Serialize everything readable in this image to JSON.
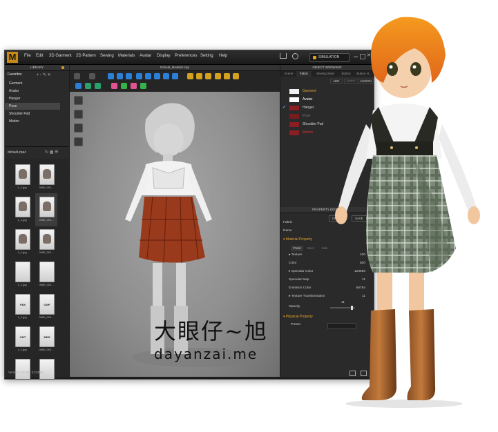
{
  "app": {
    "logo": "M",
    "menu": [
      "File",
      "Edit",
      "3D Garment",
      "2D Pattern",
      "Sewing",
      "Materials",
      "Avatar",
      "Display",
      "Preferences",
      "Setting",
      "Help"
    ],
    "simulation_label": "SIMULATION",
    "viewport_title": "Default_Modelist.zprj",
    "status_text": "Version: 2.2.107 (r12392)"
  },
  "library": {
    "header": "LIBRARY",
    "section_title": "Favorites",
    "items": [
      "Garment",
      "Avatar",
      "Hanger",
      "Pose",
      "Shoulder Pad",
      "Motion"
    ],
    "selected_item": "Pose",
    "folder_label": "default.zpac",
    "thumbnails": [
      {
        "label": "1_1.jpg",
        "tag": ""
      },
      {
        "label": "0060_001...",
        "tag": ""
      },
      {
        "label": "1_1.jpg",
        "tag": ""
      },
      {
        "label": "0060_001...",
        "tag": ""
      },
      {
        "label": "1_1.jpg",
        "tag": ""
      },
      {
        "label": "0060_001...",
        "tag": ""
      },
      {
        "label": "1_1.jpg",
        "tag": ""
      },
      {
        "label": "0060_001...",
        "tag": ""
      },
      {
        "label": "1_1.jpg",
        "tag": "FBX"
      },
      {
        "label": "0060_001...",
        "tag": "CMP"
      },
      {
        "label": "1_1.jpg",
        "tag": "CMT"
      },
      {
        "label": "0060_001...",
        "tag": "MDD"
      }
    ]
  },
  "object_browser": {
    "header": "OBJECT BROWSER",
    "tabs": [
      "Scene",
      "Fabric",
      "Sewing Style",
      "Button",
      "Button H..."
    ],
    "active_tab": "Fabric",
    "buttons": [
      "ADD",
      "COPY",
      "ASSIGN"
    ],
    "items": [
      {
        "name": "Garment",
        "color": "#f0f0f0",
        "text_color": "#e8a32c",
        "checked": false
      },
      {
        "name": "Avatar",
        "color": "#ffffff",
        "text_color": "#ffffff",
        "checked": false
      },
      {
        "name": "Hanger",
        "color": "#8a1e22",
        "text_color": "#d8d8d8",
        "checked": true
      },
      {
        "name": "Pose",
        "color": "#7a1c1e",
        "text_color": "#777777",
        "checked": false
      },
      {
        "name": "Shoulder Pad",
        "color": "#8a1e22",
        "text_color": "#d8d8d8",
        "checked": false
      },
      {
        "name": "Motion",
        "color": "#8a1e22",
        "text_color": "#e03030",
        "checked": false
      }
    ]
  },
  "property_editor": {
    "header": "PROPERTY EDITOR",
    "buttons": [
      "OPEN",
      "SAVE"
    ],
    "rows": [
      {
        "label": "Fabric",
        "value": ""
      },
      {
        "label": "Name",
        "value": ""
      }
    ],
    "material_section": "Material Property",
    "material_tabs": [
      "Front",
      "Back",
      "Side"
    ],
    "material_rows": [
      {
        "label": "Texture",
        "value": "100"
      },
      {
        "label": "Color",
        "value": "500"
      },
      {
        "label": "Specular Color",
        "value": "123566"
      },
      {
        "label": "Specular Map",
        "value": "11"
      },
      {
        "label": "Emission Color",
        "value": "56784"
      },
      {
        "label": "Texture Transformation",
        "value": "11"
      }
    ],
    "opacity_label": "Opacity",
    "opacity_value": "11",
    "physical_section": "Physical Property",
    "preset_label": "Preset"
  },
  "watermark": {
    "cn": "大眼仔~旭",
    "url": "dayanzai.me"
  },
  "colors": {
    "accent": "#e8a32c",
    "bg_dark": "#1c1c1c",
    "panel": "#2a2a2a",
    "skirt_red": "#9a3a1c",
    "plaid_green": "#6f7a66"
  }
}
